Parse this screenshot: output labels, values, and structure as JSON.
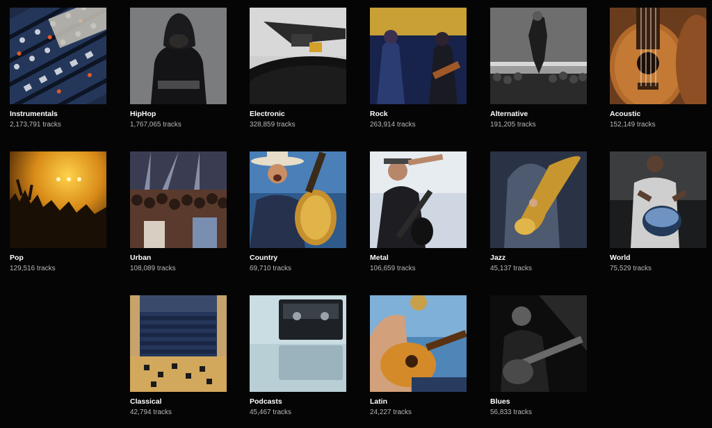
{
  "genres": [
    {
      "name": "Instrumentals",
      "count": "2,173,791 tracks",
      "image": "mixing-console-image"
    },
    {
      "name": "HipHop",
      "count": "1,767,065 tracks",
      "image": "hooded-figure-image"
    },
    {
      "name": "Electronic",
      "count": "328,859 tracks",
      "image": "turntable-stylus-image"
    },
    {
      "name": "Rock",
      "count": "263,914 tracks",
      "image": "rock-band-stage-image"
    },
    {
      "name": "Alternative",
      "count": "191,205 tracks",
      "image": "singer-over-crowd-image"
    },
    {
      "name": "Acoustic",
      "count": "152,149 tracks",
      "image": "ukulele-closeup-image"
    },
    {
      "name": "Pop",
      "count": "129,516 tracks",
      "image": "concert-crowd-silhouette-image"
    },
    {
      "name": "Urban",
      "count": "108,089 tracks",
      "image": "festival-crowd-image"
    },
    {
      "name": "Country",
      "count": "69,710 tracks",
      "image": "cowboy-guitarist-image"
    },
    {
      "name": "Metal",
      "count": "106,659 tracks",
      "image": "metal-guitarist-image"
    },
    {
      "name": "Jazz",
      "count": "45,137 tracks",
      "image": "saxophone-player-image"
    },
    {
      "name": "World",
      "count": "75,529 tracks",
      "image": "hand-drummer-image"
    },
    {
      "name": "Classical",
      "count": "42,794 tracks",
      "image": "concert-hall-image"
    },
    {
      "name": "Podcasts",
      "count": "45,467 tracks",
      "image": "cassette-tape-image"
    },
    {
      "name": "Latin",
      "count": "24,227 tracks",
      "image": "acoustic-guitarist-image"
    },
    {
      "name": "Blues",
      "count": "56,833 tracks",
      "image": "blues-guitarist-image"
    }
  ]
}
